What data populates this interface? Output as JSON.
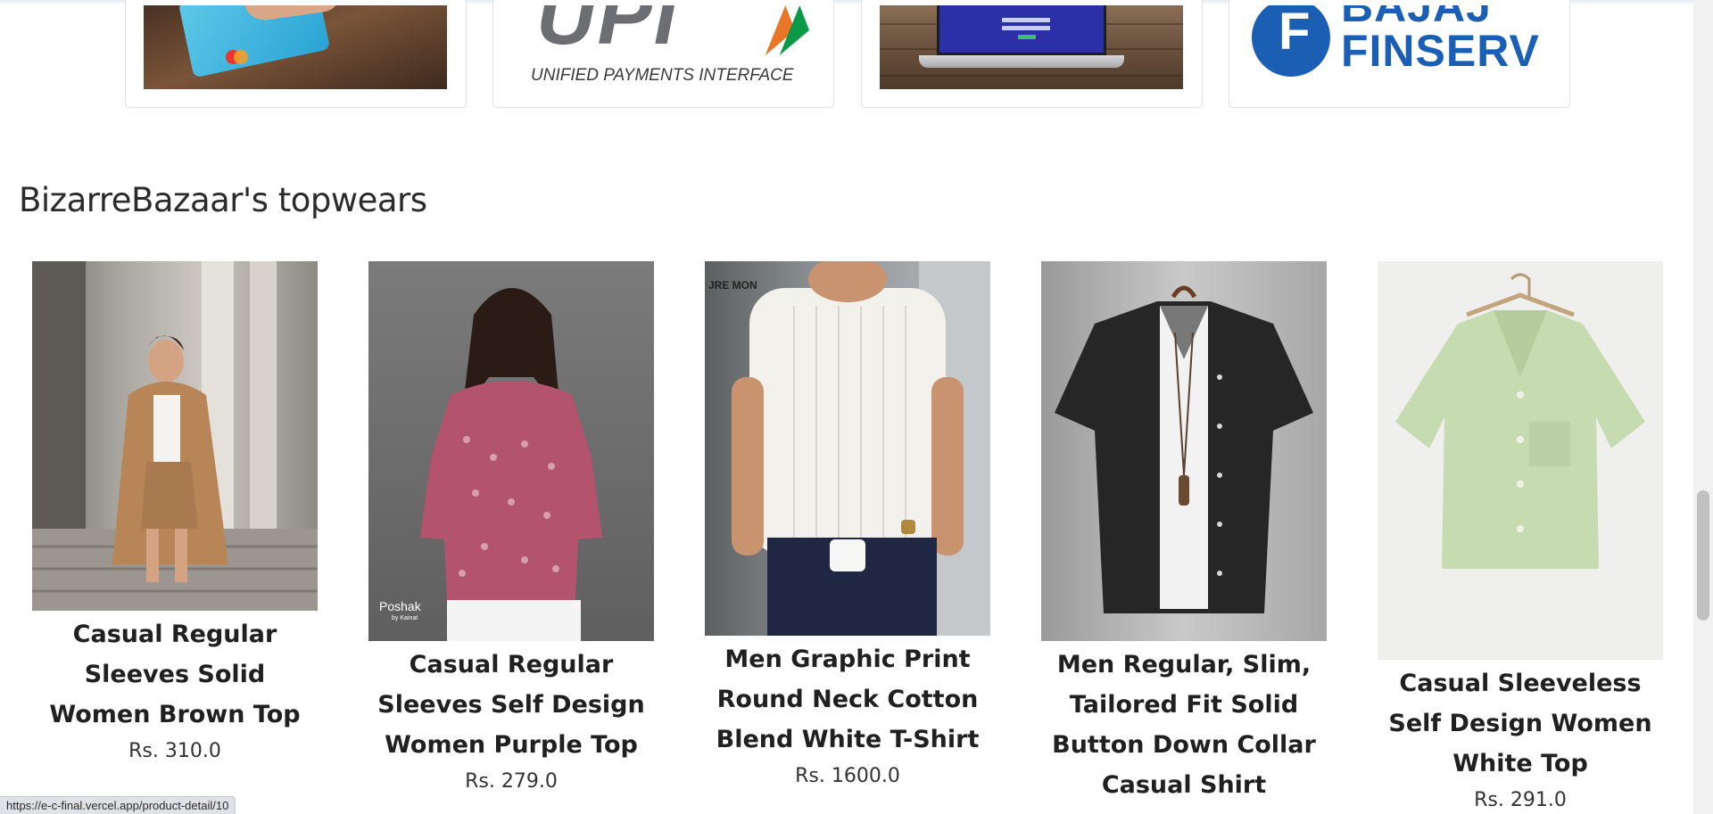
{
  "payment_methods": [
    {
      "name": "Card payment",
      "icon": "credit-card-icon"
    },
    {
      "name": "UPI",
      "logo_text": "UPI",
      "subtitle": "UNIFIED PAYMENTS INTERFACE",
      "icon": "upi-logo"
    },
    {
      "name": "Net banking",
      "icon": "laptop-icon"
    },
    {
      "name": "Bajaj Finserv",
      "logo_line1": "BAJAJ",
      "logo_line2": "FINSERV",
      "logo_letter": "F",
      "icon": "bajaj-finserv-logo"
    }
  ],
  "section": {
    "title": "BizarreBazaar's topwears"
  },
  "products": [
    {
      "name": "Casual Regular Sleeves Solid Women Brown Top",
      "price": "Rs. 310.0"
    },
    {
      "name": "Casual Regular Sleeves Self Design Women Purple Top",
      "price": "Rs. 279.0",
      "image_caption": "Poshak",
      "image_caption_small": "by Kainat"
    },
    {
      "name": "Men Graphic Print Round Neck Cotton Blend White T-Shirt",
      "price": "Rs. 1600.0",
      "image_caption": "JRE MON"
    },
    {
      "name": "Men Regular, Slim, Tailored Fit Solid Button Down Collar Casual Shirt",
      "price": ""
    },
    {
      "name": "Casual Sleeveless Self Design Women White Top",
      "price": "Rs. 291.0"
    }
  ],
  "status_bar": {
    "url": "https://e-c-final.vercel.app/product-detail/10"
  },
  "colors": {
    "brand_blue": "#1a5fb4",
    "upi_orange": "#e97626",
    "upi_green": "#0a9a47",
    "text": "#202020"
  }
}
